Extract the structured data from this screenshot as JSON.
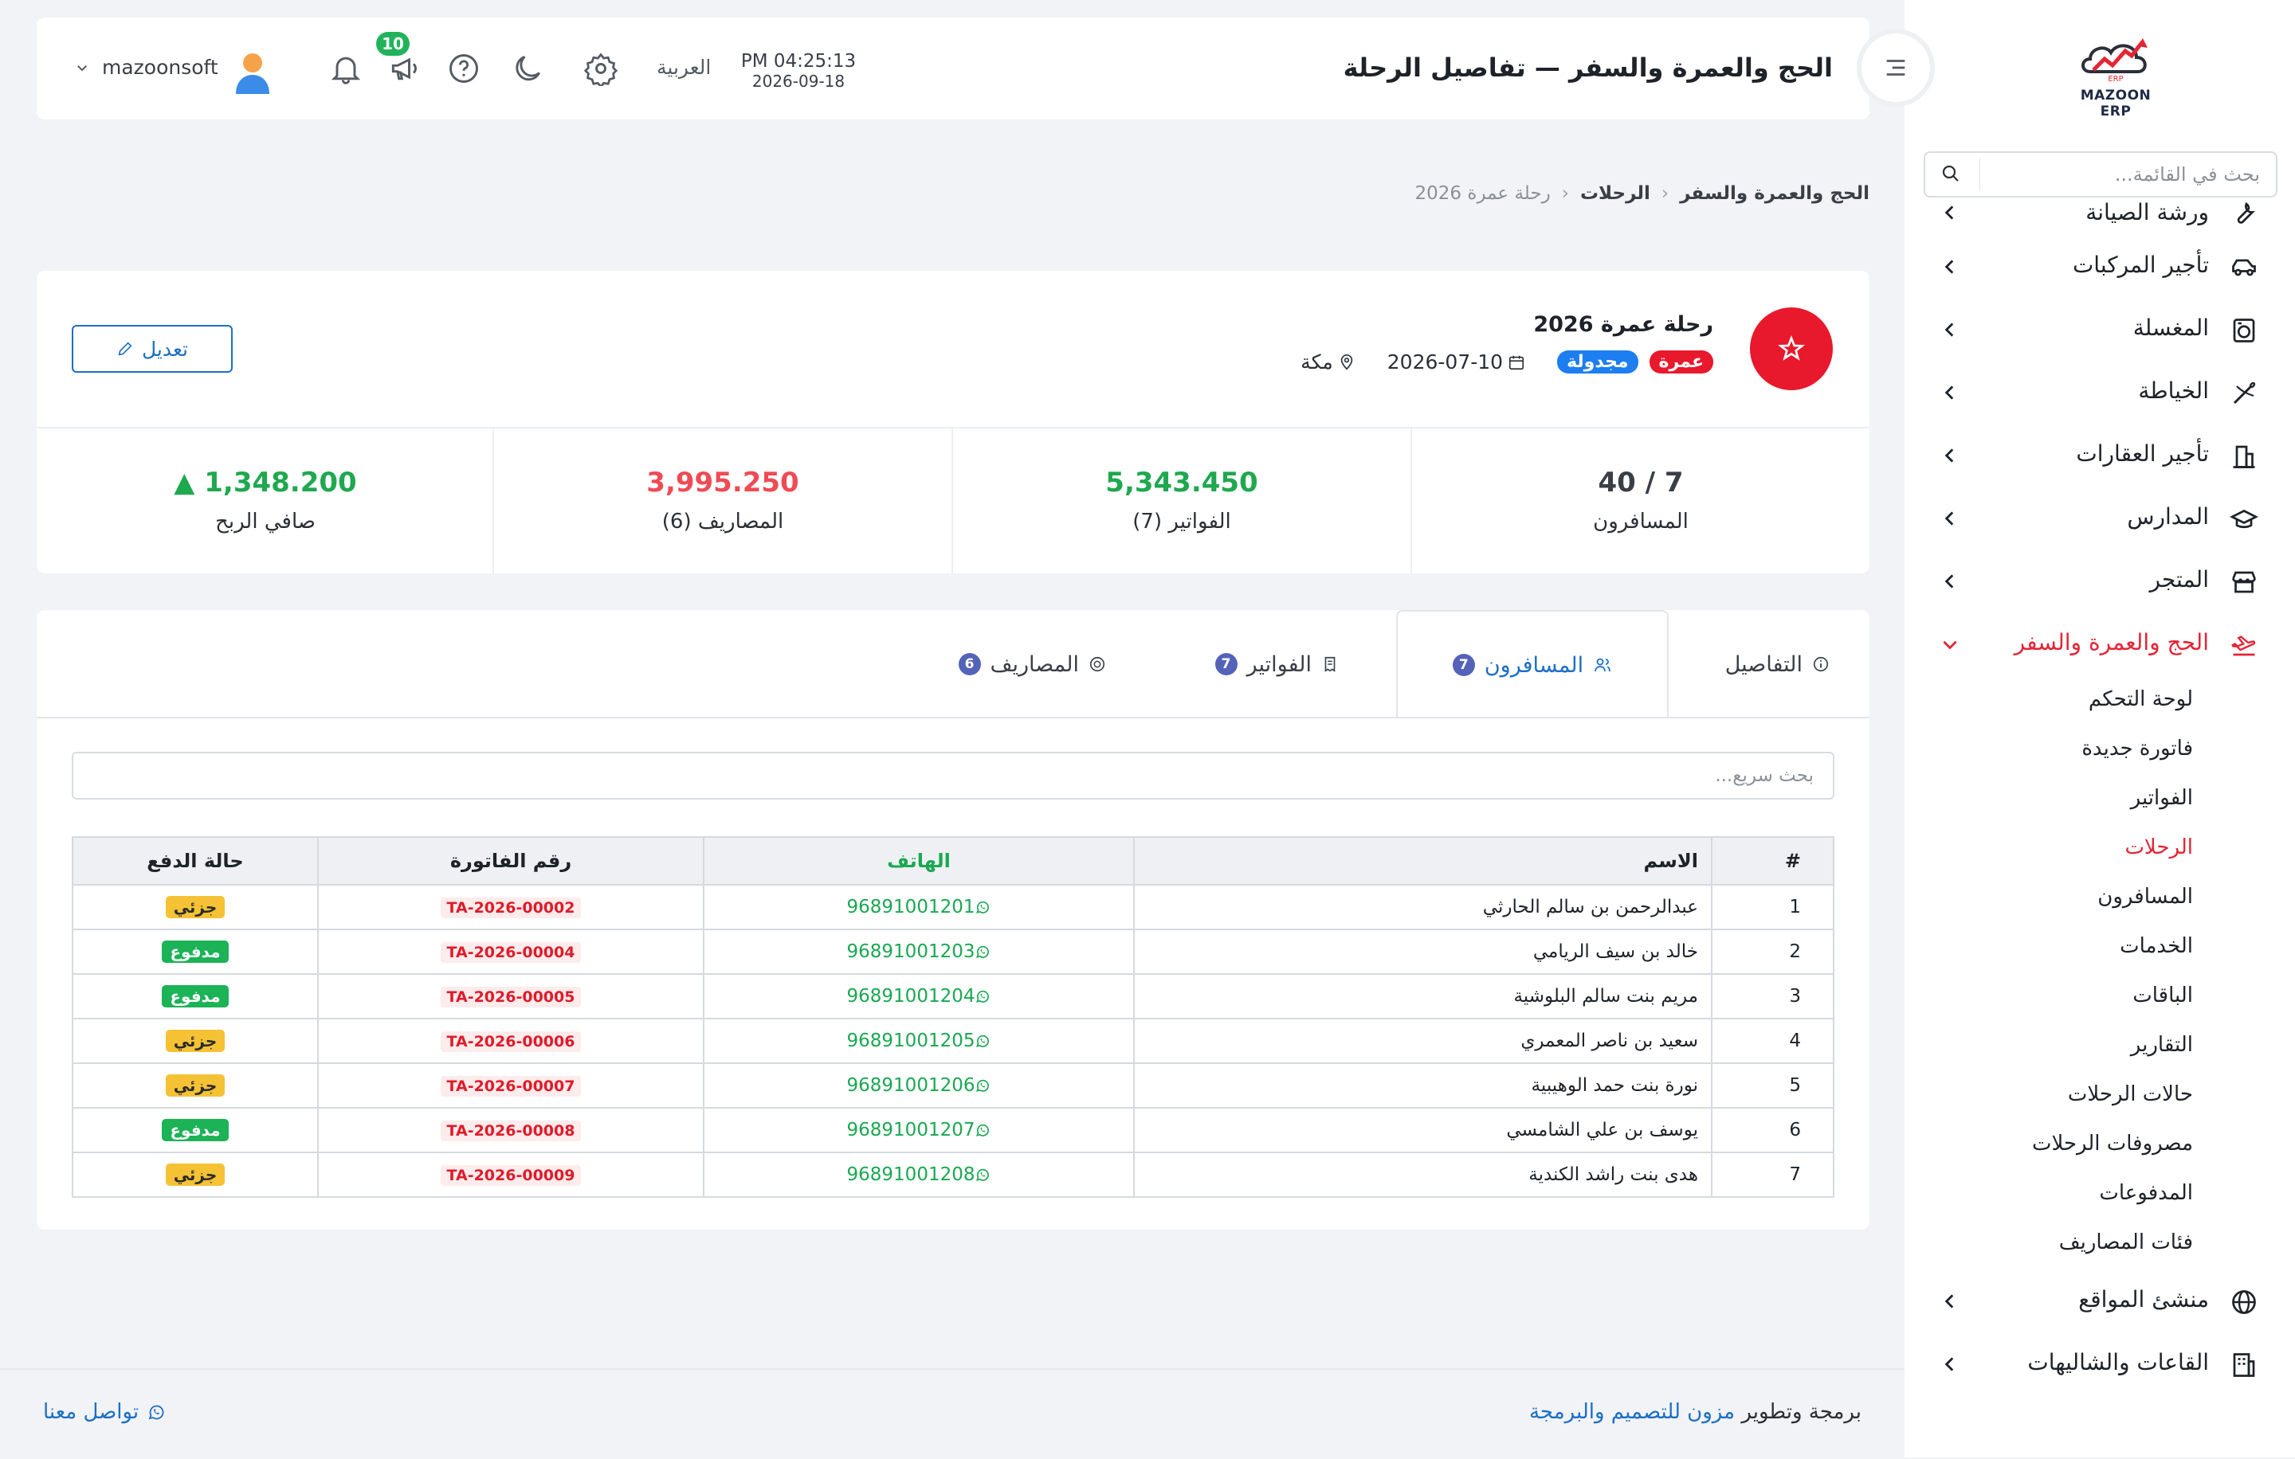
{
  "brand": {
    "logo_text": "MAZOON ERP"
  },
  "sidebar": {
    "search_placeholder": "بحث في القائمة...",
    "items": [
      {
        "label": "ورشة الصيانة",
        "icon": "wrench-icon"
      },
      {
        "label": "تأجير المركبات",
        "icon": "car-icon"
      },
      {
        "label": "المغسلة",
        "icon": "washing-machine-icon"
      },
      {
        "label": "الخياطة",
        "icon": "needle-icon"
      },
      {
        "label": "تأجير العقارات",
        "icon": "building-icon"
      },
      {
        "label": "المدارس",
        "icon": "graduation-cap-icon"
      },
      {
        "label": "المتجر",
        "icon": "store-icon"
      },
      {
        "label": "الحج والعمرة والسفر",
        "icon": "plane-icon",
        "active": true
      }
    ],
    "subitems": [
      {
        "label": "لوحة التحكم"
      },
      {
        "label": "فاتورة جديدة"
      },
      {
        "label": "الفواتير"
      },
      {
        "label": "الرحلات",
        "active": true
      },
      {
        "label": "المسافرون"
      },
      {
        "label": "الخدمات"
      },
      {
        "label": "الباقات"
      },
      {
        "label": "التقارير"
      },
      {
        "label": "حالات الرحلات"
      },
      {
        "label": "مصروفات الرحلات"
      },
      {
        "label": "المدفوعات"
      },
      {
        "label": "فئات المصاريف"
      }
    ],
    "bottom_items": [
      {
        "label": "منشئ المواقع",
        "icon": "globe-icon"
      },
      {
        "label": "القاعات والشاليهات",
        "icon": "hall-icon"
      }
    ]
  },
  "header": {
    "title": "الحج والعمرة والسفر — تفاصيل الرحلة",
    "time": "PM 04:25:13",
    "date": "2026-09-18",
    "language": "العربية",
    "notification_count": "10",
    "username": "mazoonsoft"
  },
  "breadcrumb": [
    "الحج والعمرة والسفر",
    "الرحلات",
    "رحلة عمرة 2026"
  ],
  "trip": {
    "title": "رحلة عمرة 2026",
    "type_badge": "عمرة",
    "status_badge": "مجدولة",
    "date": "2026-07-10",
    "location": "مكة",
    "edit_label": "تعديل"
  },
  "stats": [
    {
      "value": "7 / 40",
      "label": "المسافرون",
      "color": "#3a3f47"
    },
    {
      "value": "5,343.450",
      "label": "الفواتير (7)",
      "color": "#1fa84f"
    },
    {
      "value": "3,995.250",
      "label": "المصاريف (6)",
      "color": "#ef4b55"
    },
    {
      "value": "▲ 1,348.200",
      "label": "صافي الربح",
      "color": "#1fa84f"
    }
  ],
  "tabs": [
    {
      "label": "التفاصيل",
      "count": null
    },
    {
      "label": "المسافرون",
      "count": "7",
      "active": true
    },
    {
      "label": "الفواتير",
      "count": "7"
    },
    {
      "label": "المصاريف",
      "count": "6"
    }
  ],
  "table": {
    "search_placeholder": "بحث سريع...",
    "columns": [
      "#",
      "الاسم",
      "الهاتف",
      "رقم الفاتورة",
      "حالة الدفع"
    ],
    "rows": [
      {
        "num": "1",
        "name": "عبدالرحمن بن سالم الحارثي",
        "phone": "96891001201",
        "invoice": "TA-2026-00002",
        "payment": "جزئي",
        "paid": false
      },
      {
        "num": "2",
        "name": "خالد بن سيف الريامي",
        "phone": "96891001203",
        "invoice": "TA-2026-00004",
        "payment": "مدفوع",
        "paid": true
      },
      {
        "num": "3",
        "name": "مريم بنت سالم البلوشية",
        "phone": "96891001204",
        "invoice": "TA-2026-00005",
        "payment": "مدفوع",
        "paid": true
      },
      {
        "num": "4",
        "name": "سعيد بن ناصر المعمري",
        "phone": "96891001205",
        "invoice": "TA-2026-00006",
        "payment": "جزئي",
        "paid": false
      },
      {
        "num": "5",
        "name": "نورة بنت حمد الوهيبية",
        "phone": "96891001206",
        "invoice": "TA-2026-00007",
        "payment": "جزئي",
        "paid": false
      },
      {
        "num": "6",
        "name": "يوسف بن علي الشامسي",
        "phone": "96891001207",
        "invoice": "TA-2026-00008",
        "payment": "مدفوع",
        "paid": true
      },
      {
        "num": "7",
        "name": "هدى بنت راشد الكندية",
        "phone": "96891001208",
        "invoice": "TA-2026-00009",
        "payment": "جزئي",
        "paid": false
      }
    ]
  },
  "footer": {
    "credit_prefix": "برمجة وتطوير",
    "credit_link": "مزون للتصميم والبرمجة",
    "contact": "تواصل معنا"
  }
}
